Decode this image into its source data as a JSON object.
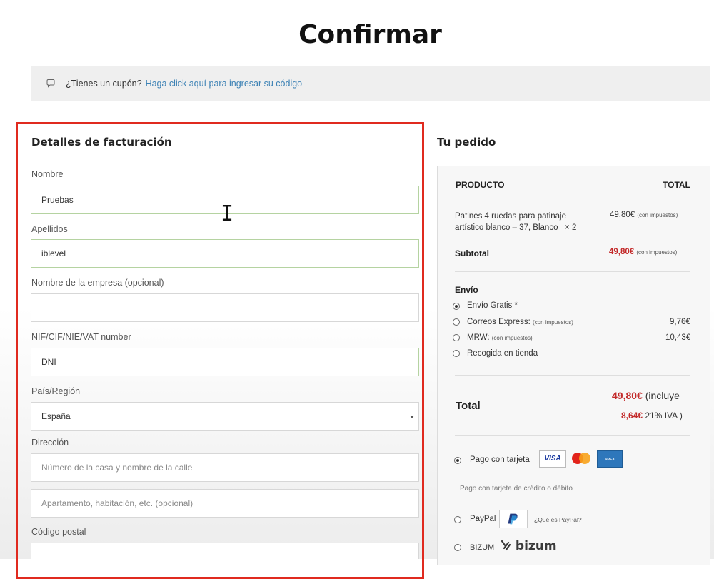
{
  "page_title": "Confirmar",
  "coupon": {
    "question": "¿Tienes un cupón?",
    "link": "Haga click aquí para ingresar su código"
  },
  "billing": {
    "heading": "Detalles de facturación",
    "fields": {
      "first_name": {
        "label": "Nombre",
        "value": "Pruebas"
      },
      "last_name": {
        "label": "Apellidos",
        "value": "iblevel"
      },
      "company": {
        "label": "Nombre de la empresa (opcional)",
        "value": ""
      },
      "tax_id": {
        "label": "NIF/CIF/NIE/VAT number",
        "value": "DNI"
      },
      "country": {
        "label": "País/Región",
        "value": "España"
      },
      "address": {
        "label": "Dirección",
        "placeholder1": "Número de la casa y nombre de la calle",
        "placeholder2": "Apartamento, habitación, etc. (opcional)"
      },
      "postcode": {
        "label": "Código postal",
        "value": ""
      }
    }
  },
  "order": {
    "heading": "Tu pedido",
    "col_product": "PRODUCTO",
    "col_total": "TOTAL",
    "item": {
      "name_line1": "Patines 4 ruedas para patinaje",
      "name_line2": "artístico blanco – 37, Blanco",
      "qty": "× 2",
      "price": "49,80€",
      "tax_note": "(con impuestos)"
    },
    "subtotal": {
      "label": "Subtotal",
      "price": "49,80€",
      "tax_note": "(con impuestos)"
    },
    "shipping": {
      "label": "Envío",
      "options": [
        {
          "label": "Envío Gratis *",
          "note": "",
          "price": "",
          "selected": true
        },
        {
          "label": "Correos Express:",
          "note": "(con impuestos)",
          "price": "9,76€",
          "selected": false
        },
        {
          "label": "MRW:",
          "note": "(con impuestos)",
          "price": "10,43€",
          "selected": false
        },
        {
          "label": "Recogida en tienda",
          "note": "",
          "price": "",
          "selected": false
        }
      ]
    },
    "total": {
      "label": "Total",
      "price": "49,80€",
      "includes": "(incluye",
      "tax_amount": "8,64€",
      "tax_label": "21% IVA )"
    },
    "payment": {
      "card": {
        "label": "Pago con tarjeta",
        "description": "Pago con tarjeta de crédito o débito",
        "selected": true
      },
      "paypal": {
        "label": "PayPal",
        "link": "¿Qué es PayPal?",
        "selected": false
      },
      "bizum": {
        "label": "BIZUM",
        "logo_text": "bizum",
        "selected": false
      }
    }
  },
  "colors": {
    "accent_red": "#c32a2a",
    "highlight_border": "#e02a1f",
    "link_blue": "#3d82b5"
  }
}
